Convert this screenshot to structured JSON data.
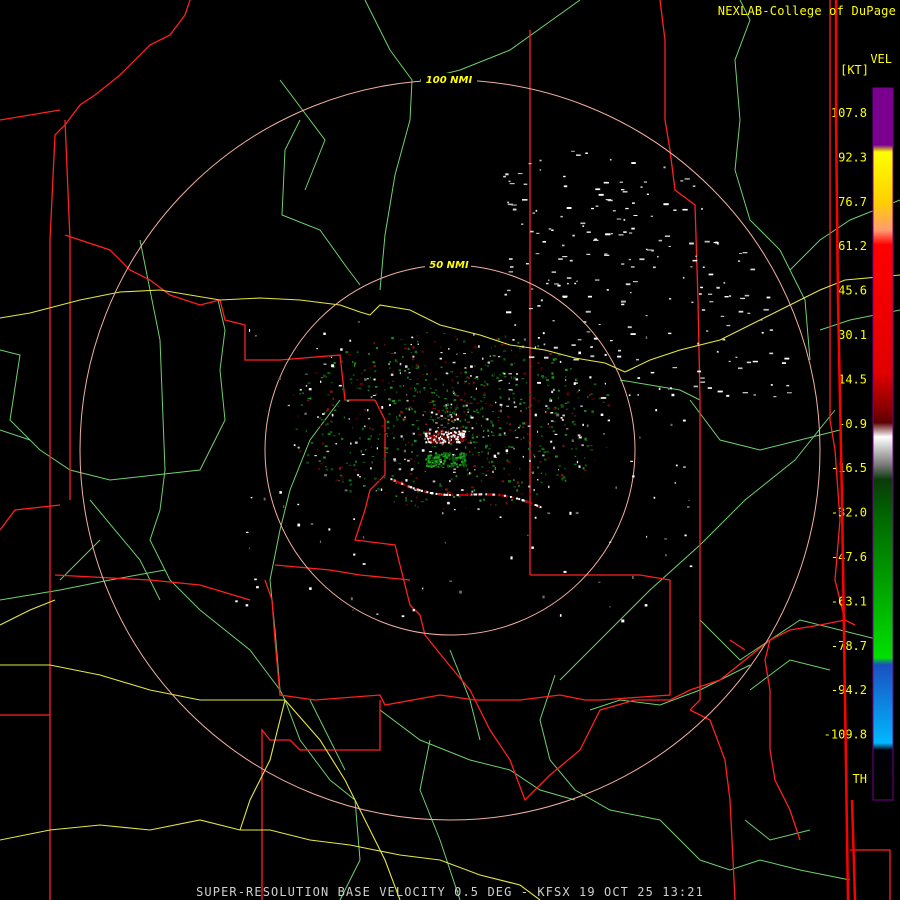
{
  "header": {
    "credit": "NEXLAB-College of DuPage",
    "product_code": "VEL",
    "units": "[KT]"
  },
  "range_rings": [
    {
      "label": "100 NMI",
      "radius_nmi": 100
    },
    {
      "label": "50 NMI",
      "radius_nmi": 50
    }
  ],
  "color_scale": {
    "labels": [
      "107.8",
      "92.3",
      "76.7",
      "61.2",
      "45.6",
      "30.1",
      "14.5",
      "-0.9",
      "-16.5",
      "-32.0",
      "-47.6",
      "-63.1",
      "-78.7",
      "-94.2",
      "-109.8",
      "TH"
    ]
  },
  "footer": {
    "caption": "SUPER-RESOLUTION BASE VELOCITY 0.5 DEG - KFSX 19 OCT 25 13:21"
  },
  "colors": {
    "state_borders": "#ff1a1a",
    "county_roads": "#7fdc7f",
    "highways": "#e8e84a",
    "range_rings": "#f0b0a0",
    "labels": "#ffff00"
  }
}
